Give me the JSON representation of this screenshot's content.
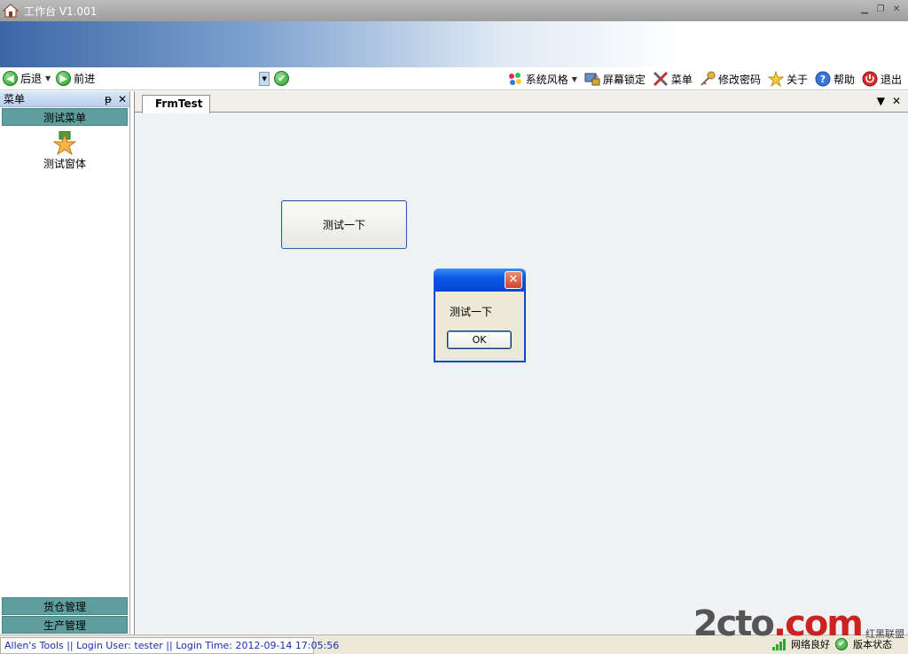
{
  "window": {
    "title": "工作台  V1.001"
  },
  "toolbar": {
    "back_label": "后退",
    "forward_label": "前进",
    "right_items": [
      {
        "label": "系统风格",
        "icon": "palette-icon"
      },
      {
        "label": "屏幕锁定",
        "icon": "screen-lock-icon"
      },
      {
        "label": "菜单",
        "icon": "tools-icon"
      },
      {
        "label": "修改密码",
        "icon": "key-icon"
      },
      {
        "label": "关于",
        "icon": "star-icon"
      },
      {
        "label": "帮助",
        "icon": "help-icon"
      },
      {
        "label": "退出",
        "icon": "exit-icon"
      }
    ]
  },
  "leftpanel": {
    "title": "菜单",
    "groups": {
      "top": "测试菜单",
      "bottom": [
        "货仓管理",
        "生产管理"
      ]
    },
    "items": [
      {
        "label": "测试窗体",
        "icon": "star-icon"
      }
    ]
  },
  "tabs": {
    "active": "FrmTest"
  },
  "content": {
    "test_button_label": "测试一下"
  },
  "msgbox": {
    "message": "测试一下",
    "ok_label": "OK"
  },
  "statusbar": {
    "text": "Allen's Tools  ||  Login User: tester  ||  Login Time: 2012-09-14 17:05:56",
    "network_label": "网络良好",
    "version_label": "版本状态"
  },
  "watermark": {
    "logo": "2cto",
    "logo_suffix": ".com",
    "sub": "红黑联盟"
  },
  "colors": {
    "group_bar": "#5e9e9f",
    "status_text": "#1a2fb0",
    "dialog_caption": "#0b58e2"
  }
}
